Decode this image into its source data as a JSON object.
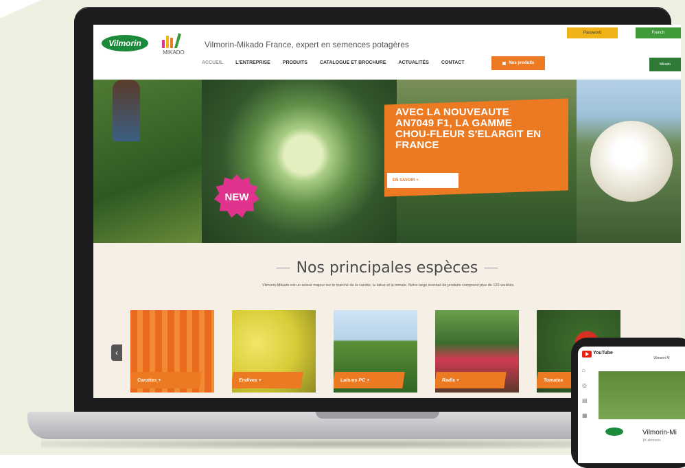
{
  "header": {
    "logo_vilmorin": "Vilmorin",
    "logo_mikado": "MIKADO",
    "tagline": "Vilmorin-Mikado France, expert en semences potagères",
    "password_btn": "Password",
    "lang_btn": "French",
    "nav": [
      "ACCUEIL",
      "L'ENTREPRISE",
      "PRODUITS",
      "CATALOGUE ET BROCHURE",
      "ACTUALITÉS",
      "CONTACT"
    ],
    "products_btn": "Nos produits",
    "right_btn": "Mikado"
  },
  "hero": {
    "badge": "NEW",
    "headline": "AVEC LA NOUVEAUTE AN7049 F1, LA GAMME CHOU-FLEUR S'ELARGIT EN FRANCE",
    "cta": "EN SAVOIR +"
  },
  "species": {
    "title": "Nos principales espèces",
    "description": "Vilmorin-Mikado est un acteur majeur sur le marché de la carotte, la laitue et la tomate. Notre large éventail de produits comprend plus de 120 variétés.",
    "prev": "‹",
    "cards": [
      "Carottes +",
      "Endives +",
      "Laitues PC +",
      "Radis +",
      "Tomates"
    ]
  },
  "phone": {
    "app": "YouTube",
    "header_right": "Vilmorin M",
    "channel": "Vilmorin-Mi",
    "subscribers": "1K abonnés"
  },
  "colors": {
    "accent_orange": "#ec7a23",
    "brand_green": "#1b8a3a",
    "badge_pink": "#e0338e",
    "page_bg": "#f6efe6"
  }
}
